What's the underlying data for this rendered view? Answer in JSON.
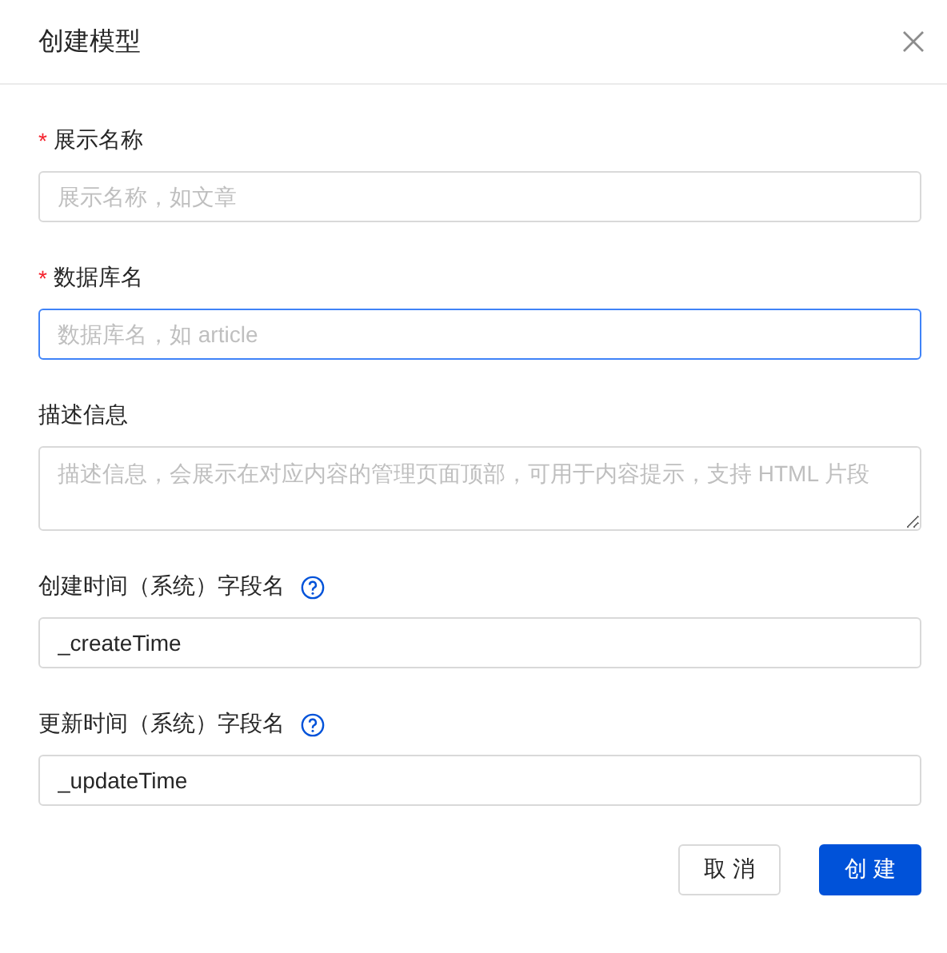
{
  "dialog": {
    "title": "创建模型"
  },
  "fields": [
    {
      "kind": "input",
      "label": "展示名称",
      "required_mark": "*",
      "placeholder": "展示名称，如文章",
      "focused": false,
      "help": false
    },
    {
      "kind": "input",
      "label": "数据库名",
      "required_mark": "*",
      "placeholder": "数据库名，如 article",
      "focused": true,
      "help": false
    },
    {
      "kind": "textarea",
      "label": "描述信息",
      "placeholder": "描述信息，会展示在对应内容的管理页面顶部，可用于内容提示，支持 HTML 片段",
      "focused": false,
      "help": false
    },
    {
      "kind": "input",
      "label": "创建时间（系统）字段名",
      "value": "_createTime",
      "focused": false,
      "help": true
    },
    {
      "kind": "input",
      "label": "更新时间（系统）字段名",
      "value": "_updateTime",
      "focused": false,
      "help": true
    }
  ],
  "buttons": [
    {
      "kind": "default",
      "label": "取 消"
    },
    {
      "kind": "primary",
      "label": "创 建"
    }
  ]
}
